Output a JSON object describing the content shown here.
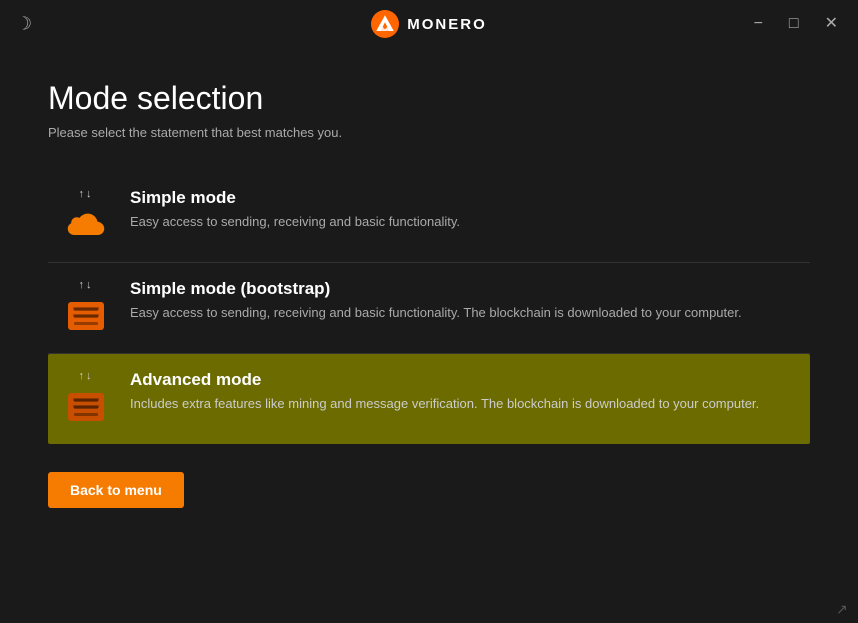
{
  "titlebar": {
    "title": "MONERO",
    "minimize_label": "−",
    "maximize_label": "□",
    "close_label": "✕"
  },
  "page": {
    "title": "Mode selection",
    "subtitle": "Please select the statement that best matches you."
  },
  "modes": [
    {
      "id": "simple",
      "name": "Simple mode",
      "description": "Easy access to sending, receiving and basic functionality.",
      "icon_type": "cloud",
      "selected": false
    },
    {
      "id": "bootstrap",
      "name": "Simple mode (bootstrap)",
      "description": "Easy access to sending, receiving and basic functionality. The blockchain is downloaded to your computer.",
      "icon_type": "box",
      "selected": false
    },
    {
      "id": "advanced",
      "name": "Advanced mode",
      "description": "Includes extra features like mining and message verification. The blockchain is downloaded to your computer.",
      "icon_type": "box",
      "selected": true
    }
  ],
  "back_button": {
    "label": "Back to menu"
  }
}
